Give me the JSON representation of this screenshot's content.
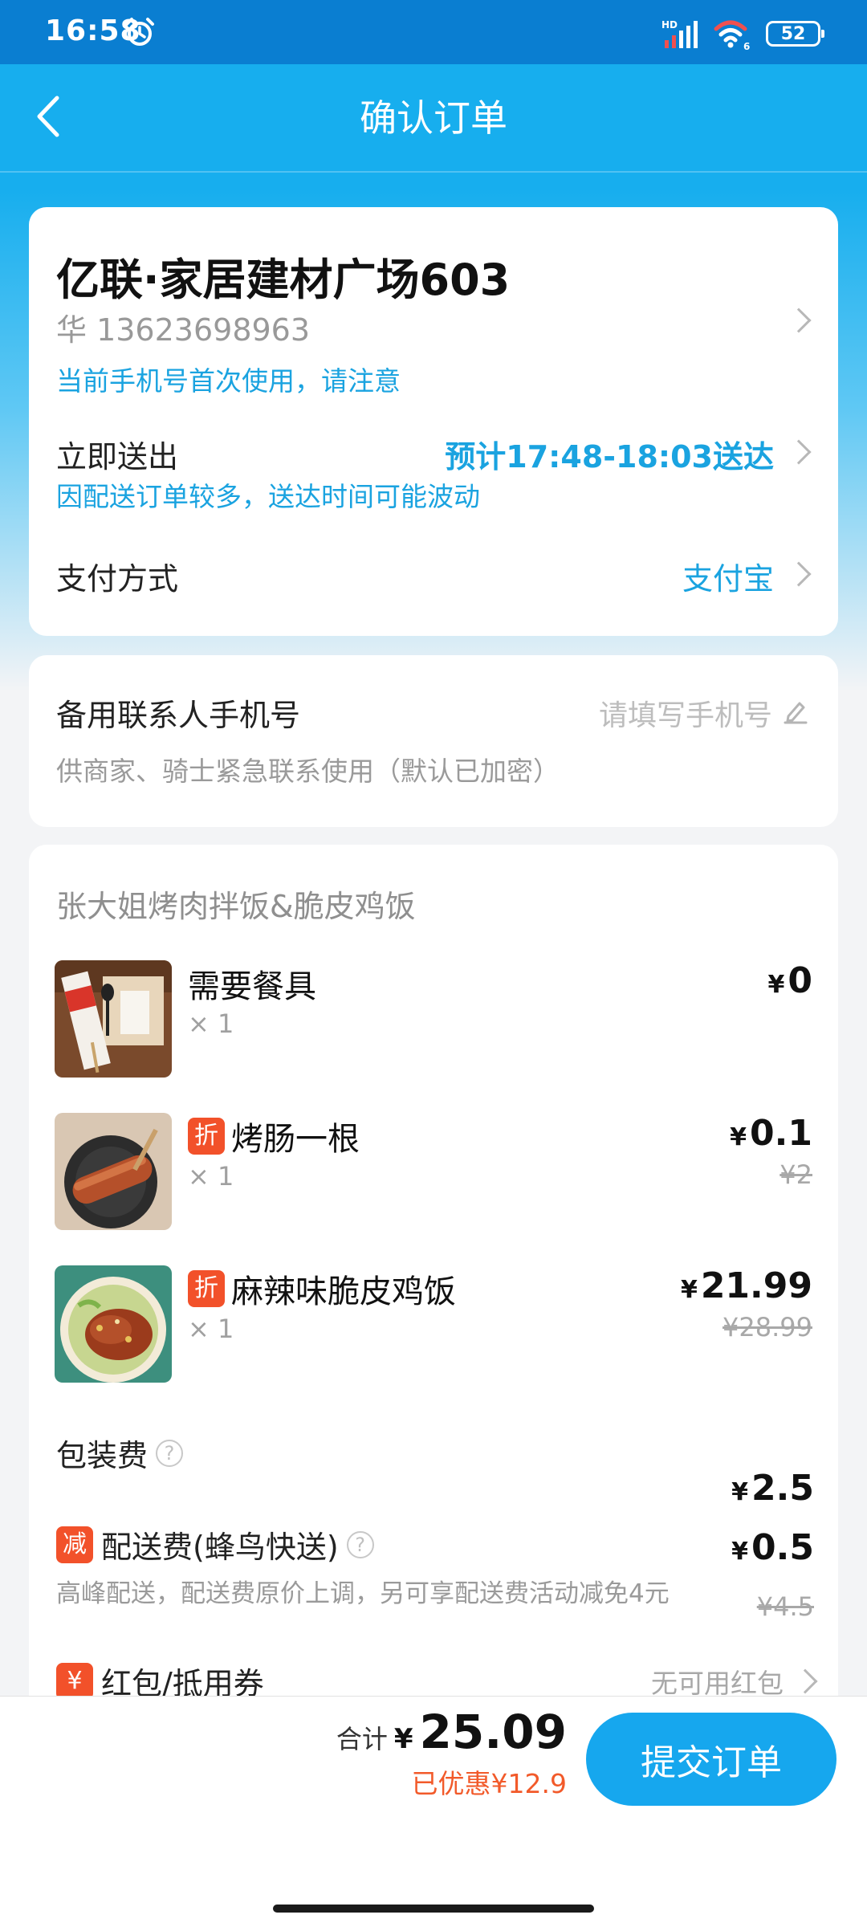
{
  "status_bar": {
    "time": "16:58",
    "signal_label": "HD",
    "wifi_label": "6",
    "battery": "52"
  },
  "nav": {
    "title": "确认订单"
  },
  "address": {
    "title": "亿联·家居建材广场603",
    "contact": "华  13623698963",
    "warning": "当前手机号首次使用，请注意",
    "delivery_label": "立即送出",
    "delivery_eta": "预计17:48-18:03送达",
    "delivery_note": "因配送订单较多，送达时间可能波动",
    "payment_label": "支付方式",
    "payment_value": "支付宝"
  },
  "backup_contact": {
    "label": "备用联系人手机号",
    "placeholder": "请填写手机号",
    "hint": "供商家、骑士紧急联系使用（默认已加密）"
  },
  "order": {
    "shop_name": "张大姐烤肉拌饭&脆皮鸡饭",
    "items": [
      {
        "name": "需要餐具",
        "tag": "",
        "qty": "× 1",
        "price": "0",
        "original_price": ""
      },
      {
        "name": "烤肠一根",
        "tag": "折",
        "qty": "× 1",
        "price": "0.1",
        "original_price": "¥2"
      },
      {
        "name": "麻辣味脆皮鸡饭",
        "tag": "折",
        "qty": "× 1",
        "price": "21.99",
        "original_price": "¥28.99"
      }
    ],
    "packaging": {
      "label": "包装费",
      "price": "2.5"
    },
    "delivery_fee": {
      "tag": "减",
      "label": "配送费(蜂鸟快送)",
      "note": "高峰配送，配送费原价上调，另可享配送费活动减免4元",
      "price": "0.5",
      "original_price": "¥4.5"
    },
    "coupon": {
      "tag": "¥",
      "label": "红包/抵用券",
      "value": "无可用红包"
    }
  },
  "footer": {
    "total_label": "合计",
    "currency": "¥",
    "total": "25.09",
    "saved": "已优惠¥12.9",
    "submit": "提交订单"
  },
  "colors": {
    "accent": "#16a7ee",
    "discount": "#f25a2a",
    "header": "#17aeee"
  }
}
